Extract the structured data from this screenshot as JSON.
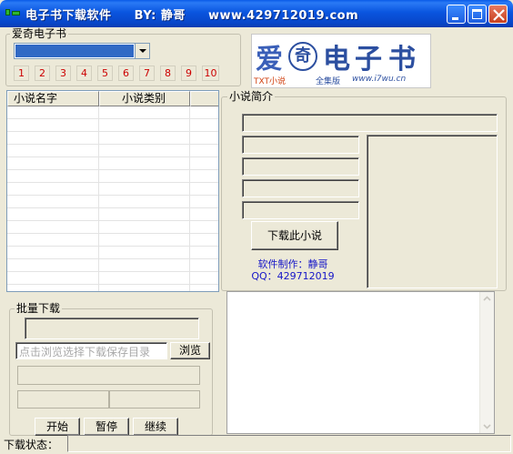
{
  "window": {
    "title": "电子书下载软件     BY: 静哥     www.429712019.com"
  },
  "category_group": {
    "label": "爱奇电子书",
    "page_buttons": [
      "1",
      "2",
      "3",
      "4",
      "5",
      "6",
      "7",
      "8",
      "9",
      "10"
    ]
  },
  "logo": {
    "char1": "爱",
    "char2": "奇",
    "char3": "电",
    "char4": "子",
    "char5": "书",
    "tag_txt": "TXT小说",
    "tag_full": "全集版",
    "url": "www.i7wu.cn"
  },
  "novel_list": {
    "columns": [
      "小说名字",
      "小说类别"
    ]
  },
  "intro_group": {
    "label": "小说简介",
    "download_button": "下载此小说",
    "author_line": "软件制作：静哥",
    "qq_line": "QQ：429712019"
  },
  "batch_group": {
    "label": "批量下载",
    "path_placeholder": "点击浏览选择下载保存目录",
    "browse_button": "浏览",
    "start_button": "开始",
    "pause_button": "暂停",
    "continue_button": "继续"
  },
  "status_bar": {
    "label": "下载状态："
  }
}
